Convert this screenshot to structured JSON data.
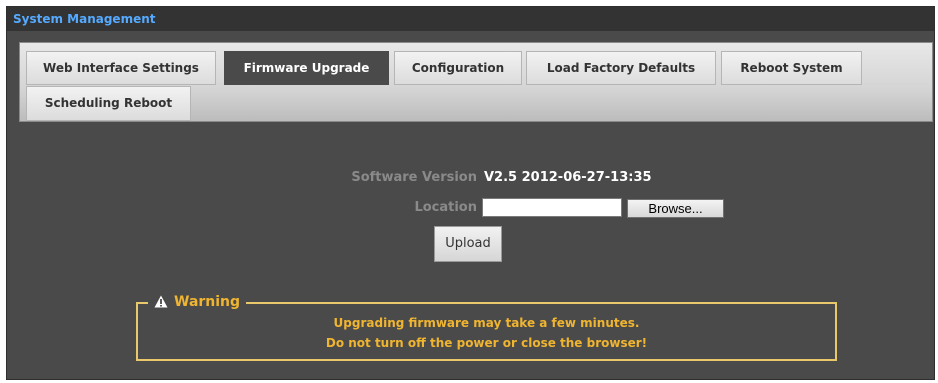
{
  "panel": {
    "title": "System Management"
  },
  "tabs": [
    {
      "label": "Web Interface Settings",
      "active": false
    },
    {
      "label": "Firmware Upgrade",
      "active": true
    },
    {
      "label": "Configuration",
      "active": false
    },
    {
      "label": "Load Factory Defaults",
      "active": false
    },
    {
      "label": "Reboot System",
      "active": false
    },
    {
      "label": "Scheduling Reboot",
      "active": false
    }
  ],
  "firmware": {
    "version_label": "Software Version",
    "version_value": "V2.5 2012-06-27-13:35",
    "location_label": "Location",
    "location_value": "",
    "browse_label": "Browse...",
    "upload_label": "Upload"
  },
  "warning": {
    "icon": "warning-triangle-icon",
    "title": "Warning",
    "line1": "Upgrading firmware may take a few minutes.",
    "line2": "Do not turn off the power or close the browser!"
  },
  "colors": {
    "panel_bg": "#4a4a4a",
    "title_text": "#55aaff",
    "warning": "#f0b530",
    "warning_border": "#e8c86a"
  }
}
